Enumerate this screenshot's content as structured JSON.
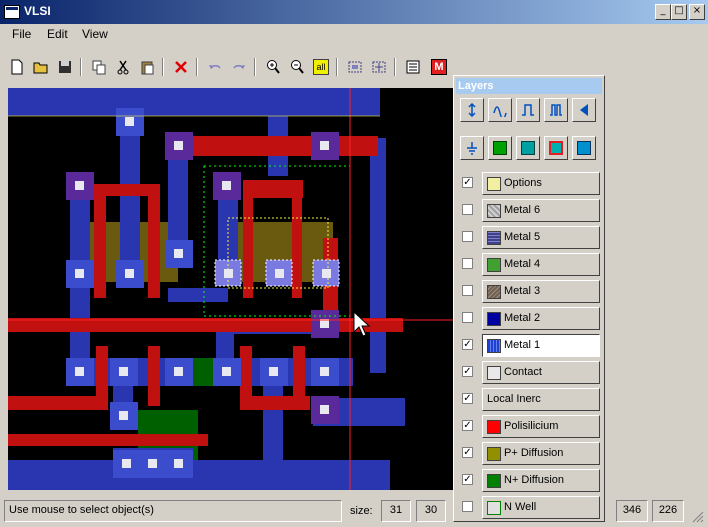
{
  "window": {
    "title": "VLSI",
    "minimize": "_",
    "maximize": "□",
    "close": "×"
  },
  "menu": [
    {
      "label": "File"
    },
    {
      "label": "Edit"
    },
    {
      "label": "View"
    }
  ],
  "toolbar": [
    {
      "name": "new-file-icon"
    },
    {
      "name": "open-folder-icon"
    },
    {
      "name": "save-icon"
    },
    {
      "name": "copy-icon"
    },
    {
      "name": "cut-icon"
    },
    {
      "name": "paste-icon"
    },
    {
      "name": "delete-icon"
    },
    {
      "name": "undo-icon"
    },
    {
      "name": "redo-icon"
    },
    {
      "name": "zoom-in-icon"
    },
    {
      "name": "zoom-out-icon"
    },
    {
      "name": "zoom-all-icon",
      "label": "all"
    },
    {
      "name": "select-region-icon"
    },
    {
      "name": "select-move-icon"
    },
    {
      "name": "list-view-icon"
    },
    {
      "name": "metal-view-icon",
      "label": "M"
    }
  ],
  "layers_panel": {
    "title": "Layers",
    "tools_row1": [
      "via-icon",
      "wire-icon",
      "pulse-icon",
      "double-pulse-icon",
      "arrow-left-icon"
    ],
    "tools_row2": [
      "ground-icon",
      "nmos-icon",
      "pmos-icon",
      "cell-icon",
      "contact-tool-icon"
    ],
    "rows": [
      {
        "label": "Options",
        "checked": true,
        "color": "#f0f0a0"
      },
      {
        "label": "Metal 6",
        "checked": false,
        "color": "#a0a0a0"
      },
      {
        "label": "Metal 5",
        "checked": false,
        "color": "#404090"
      },
      {
        "label": "Metal 4",
        "checked": false,
        "color": "#40a030"
      },
      {
        "label": "Metal 3",
        "checked": false,
        "color": "#706050"
      },
      {
        "label": "Metal 2",
        "checked": false,
        "color": "#0000a0"
      },
      {
        "label": "Metal 1",
        "checked": true,
        "color": "#2040d0",
        "active": true
      },
      {
        "label": "Contact",
        "checked": true,
        "color": "#e8e8e8"
      },
      {
        "label": "Local Inerc",
        "checked": true,
        "color": ""
      },
      {
        "label": "Polisilicium",
        "checked": true,
        "color": "#ff0000"
      },
      {
        "label": "P+ Diffusion",
        "checked": true,
        "color": "#909000"
      },
      {
        "label": "N+ Diffusion",
        "checked": true,
        "color": "#008000"
      },
      {
        "label": "N Well",
        "checked": false,
        "color": "#e0e0e0"
      }
    ]
  },
  "status": {
    "message": "Use mouse to select object(s)",
    "size_label": "size:",
    "size_w": "31",
    "size_h": "30",
    "coord_x": "346",
    "coord_y": "226"
  },
  "colors": {
    "metal1": "#2a35b0",
    "poly": "#c01010",
    "contact": "#5a2a9a",
    "ndiff": "#006000",
    "pdiff": "#6a5a10"
  }
}
